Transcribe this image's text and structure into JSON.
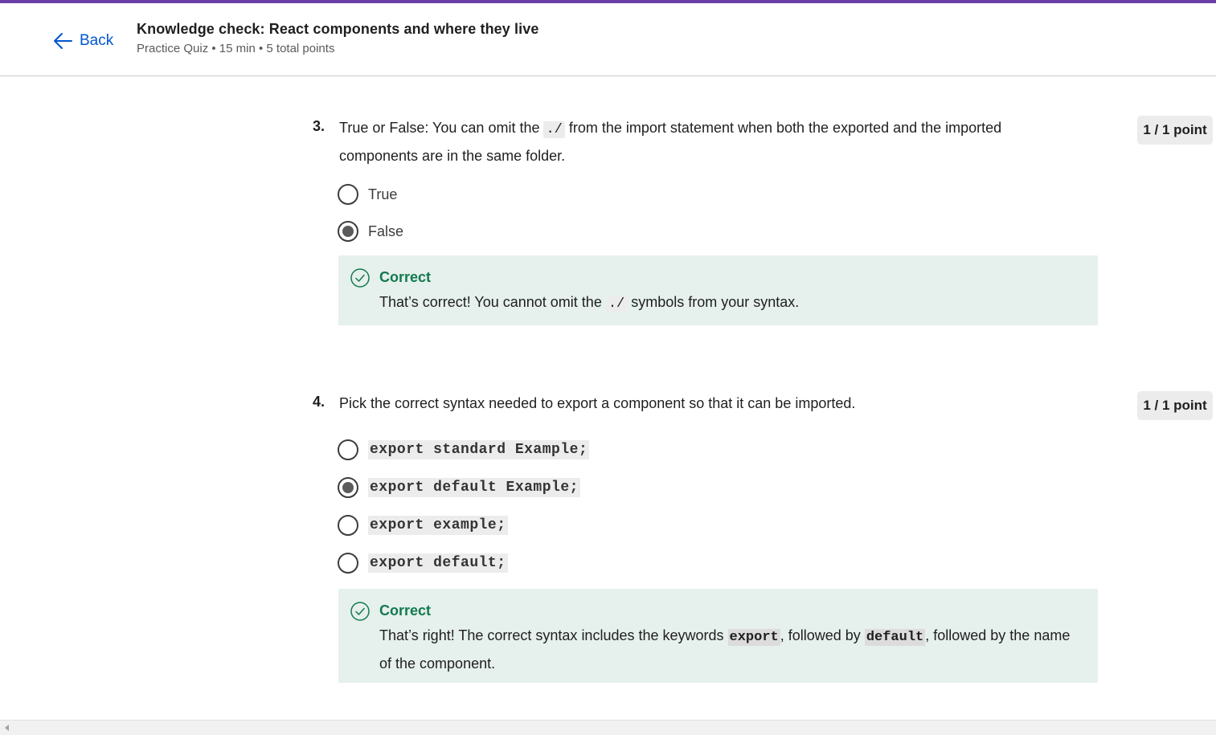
{
  "header": {
    "back_label": "Back",
    "title": "Knowledge check: React components and where they live",
    "meta": "Practice Quiz • 15 min • 5 total points",
    "accent_color": "#6c3fa8"
  },
  "questions": [
    {
      "number": "3.",
      "text_before": "True or False: You can omit the ",
      "text_code": "./",
      "text_after": " from the import statement when both the exported and the imported components are in the same folder.",
      "points": "1 / 1 point",
      "options": [
        {
          "label": "True",
          "selected": false
        },
        {
          "label": "False",
          "selected": true
        }
      ],
      "feedback": {
        "title": "Correct",
        "text_before": "That’s correct! You cannot omit the ",
        "code": "./",
        "text_after": " symbols from your syntax."
      }
    },
    {
      "number": "4.",
      "text": "Pick the correct syntax needed to export a component so that it can be imported.",
      "points": "1 / 1 point",
      "options": [
        {
          "label": "export standard Example;",
          "selected": false
        },
        {
          "label": "export default Example;",
          "selected": true
        },
        {
          "label": "export example;",
          "selected": false
        },
        {
          "label": "export default;",
          "selected": false
        }
      ],
      "feedback": {
        "title": "Correct",
        "text_1": "That’s right! The correct syntax includes the keywords ",
        "code_1": "export",
        "text_2": ", followed by ",
        "code_2": "default",
        "text_3": ", followed by the name of the component."
      }
    }
  ],
  "colors": {
    "link_blue": "#0056d2",
    "correct_green": "#137a50",
    "feedback_bg": "#e6f0ec"
  },
  "icons": {
    "back": "arrow-left-icon",
    "feedback": "check-circle-icon",
    "scroll": "scroll-left-arrow-icon"
  }
}
